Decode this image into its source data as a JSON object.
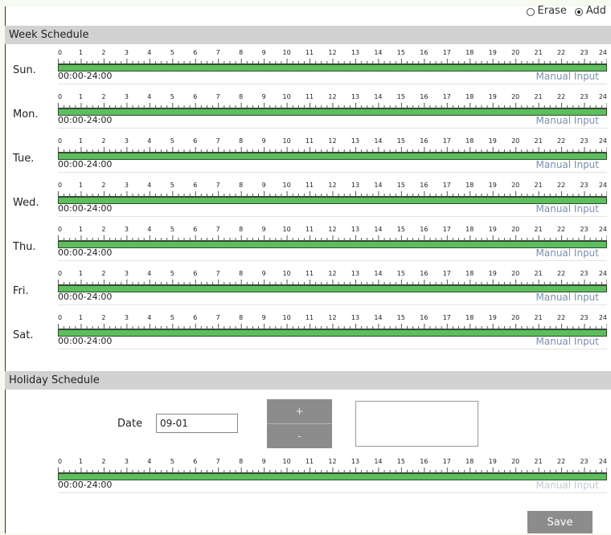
{
  "mode": {
    "erase_label": "Erase",
    "add_label": "Add",
    "selected": "Add"
  },
  "week": {
    "title": "Week Schedule",
    "days": [
      {
        "label": "Sun.",
        "range": "00:00-24:00",
        "manual": "Manual Input"
      },
      {
        "label": "Mon.",
        "range": "00:00-24:00",
        "manual": "Manual Input"
      },
      {
        "label": "Tue.",
        "range": "00:00-24:00",
        "manual": "Manual Input"
      },
      {
        "label": "Wed.",
        "range": "00:00-24:00",
        "manual": "Manual Input"
      },
      {
        "label": "Thu.",
        "range": "00:00-24:00",
        "manual": "Manual Input"
      },
      {
        "label": "Fri.",
        "range": "00:00-24:00",
        "manual": "Manual Input"
      },
      {
        "label": "Sat.",
        "range": "00:00-24:00",
        "manual": "Manual Input"
      }
    ]
  },
  "hours": [
    "0",
    "1",
    "2",
    "3",
    "4",
    "5",
    "6",
    "7",
    "8",
    "9",
    "10",
    "11",
    "12",
    "13",
    "14",
    "15",
    "16",
    "17",
    "18",
    "19",
    "20",
    "21",
    "22",
    "23",
    "24"
  ],
  "holiday": {
    "title": "Holiday Schedule",
    "date_label": "Date",
    "date_value": "09-01",
    "add_label": "+",
    "remove_label": "-",
    "range": "00:00-24:00",
    "manual": "Manual Input"
  },
  "save_label": "Save",
  "colors": {
    "bar": "#5cbf5c",
    "header": "#d2d2d2",
    "button": "#8c8c8c",
    "link": "#7a8fb0"
  }
}
